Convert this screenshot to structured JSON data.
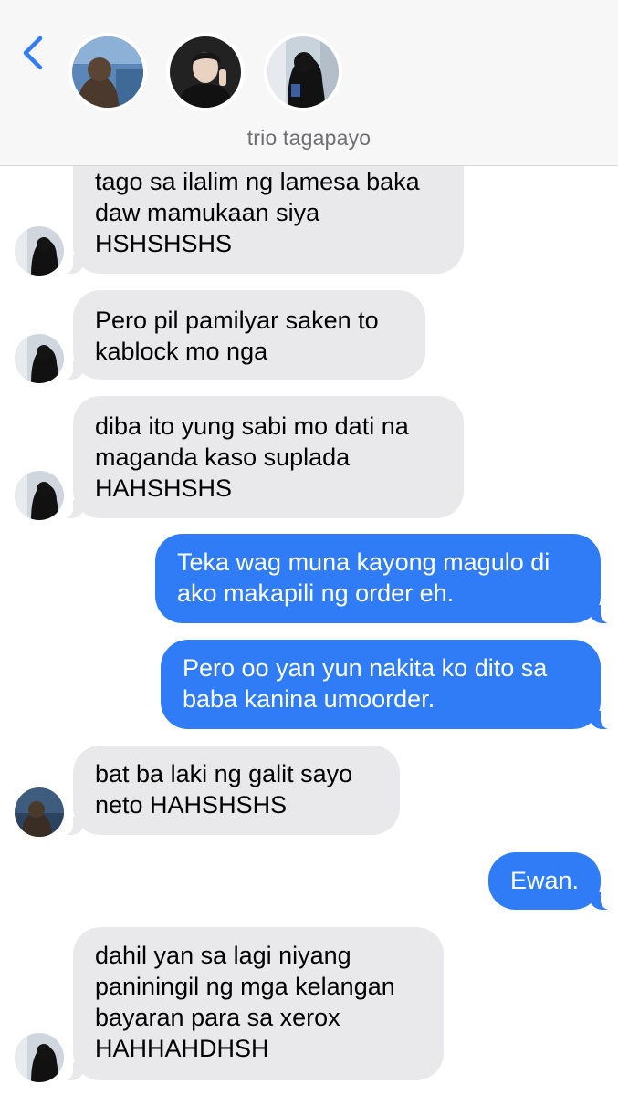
{
  "header": {
    "group_name": "trio tagapayo",
    "back_icon": "chevron-left-icon",
    "accent_color": "#2f7cf6"
  },
  "participants": [
    {
      "avatar": "avatar-person-window"
    },
    {
      "avatar": "avatar-person-peace-sign"
    },
    {
      "avatar": "avatar-person-long-hair"
    }
  ],
  "messages": [
    {
      "direction": "in",
      "sender_avatar": "avatar-person-long-hair",
      "text": "tago sa ilalim ng lamesa baka\ndaw mamukaan siya\nHSHSHSHS"
    },
    {
      "direction": "in",
      "sender_avatar": "avatar-person-long-hair",
      "text": "Pero pil pamilyar saken to\nkablock mo nga"
    },
    {
      "direction": "in",
      "sender_avatar": "avatar-person-long-hair",
      "text": "diba ito yung sabi mo dati na\nmaganda kaso suplada\nHAHSHSHS"
    },
    {
      "direction": "out",
      "text": "Teka wag muna kayong magulo di\nako makapili ng order eh."
    },
    {
      "direction": "out",
      "text": "Pero oo yan yun nakita ko dito sa\nbaba kanina umoorder."
    },
    {
      "direction": "in",
      "sender_avatar": "avatar-person-window",
      "text": "bat ba laki ng galit sayo\nneto HAHSHSHS"
    },
    {
      "direction": "out",
      "text": "Ewan."
    },
    {
      "direction": "in",
      "sender_avatar": "avatar-person-long-hair",
      "text": "dahil yan sa lagi niyang\npaniningil ng mga kelangan\nbayaran para sa xerox\nHAHHAHDHSH"
    }
  ]
}
